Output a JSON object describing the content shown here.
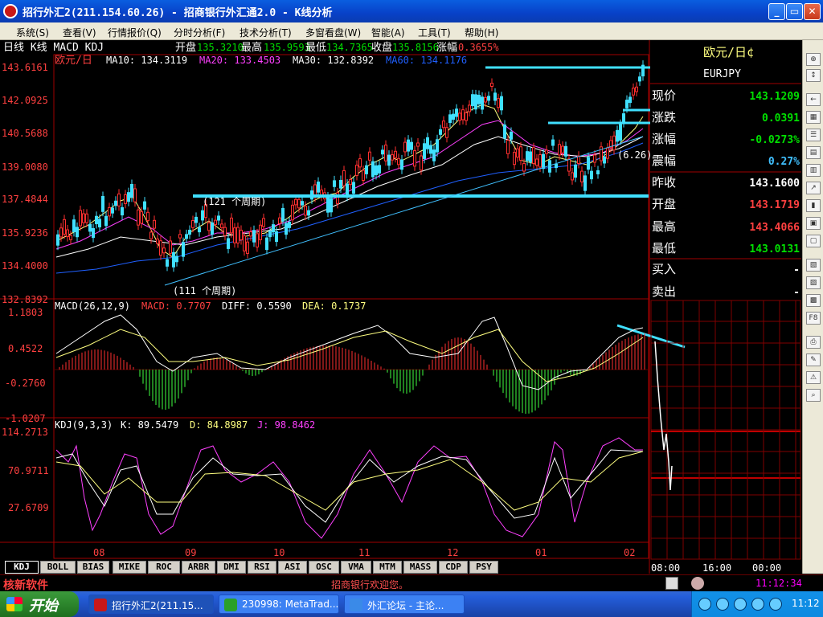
{
  "window": {
    "title": "招行外汇2(211.154.60.26) - 招商银行外汇通2.0 - K线分析"
  },
  "menu": [
    "系统(S)",
    "查看(V)",
    "行情报价(Q)",
    "分时分析(F)",
    "技术分析(T)",
    "多窗看盘(W)",
    "智能(A)",
    "工具(T)",
    "帮助(H)"
  ],
  "chart_header": {
    "mode": "日线 K线 MACD KDJ",
    "open_label": "开盘",
    "open": "135.3210",
    "high_label": "最高",
    "high": "135.9593",
    "low_label": "最低",
    "low": "134.7365",
    "close_label": "收盘",
    "close": "135.8156",
    "chg_label": "涨幅",
    "chg": "0.3655%"
  },
  "symbol_label": "欧元/日",
  "ma_legend": [
    {
      "text": "MA10: 134.3119",
      "color": "#ffffff"
    },
    {
      "text": "MA20: 133.4503",
      "color": "#ff40ff"
    },
    {
      "text": "MA30: 132.8392",
      "color": "#ffffff"
    },
    {
      "text": "MA60: 134.1176",
      "color": "#2060ff"
    }
  ],
  "price_axis": [
    "143.6161",
    "142.0925",
    "140.5688",
    "139.0080",
    "137.4844",
    "135.9236",
    "134.4000",
    "132.8392"
  ],
  "annotations": {
    "p121": "(121 个周期)",
    "p111": "(111 个周期)",
    "p6": "(6.26)"
  },
  "macd_header": {
    "label": "MACD(26,12,9)",
    "macd": "MACD: 0.7707",
    "diff": "DIFF: 0.5590",
    "dea": "DEA: 0.1737"
  },
  "macd_axis": [
    "1.1803",
    "0.4522",
    "-0.2760",
    "-1.0207"
  ],
  "kdj_header": {
    "label": "KDJ(9,3,3)",
    "k": "K: 89.5479",
    "d": "D: 84.8987",
    "j": "J: 98.8462"
  },
  "kdj_axis": [
    "114.2713",
    "70.9711",
    "27.6709"
  ],
  "x_axis": [
    "08",
    "09",
    "10",
    "11",
    "12",
    "01",
    "02"
  ],
  "intraday_axis": [
    "08:00",
    "16:00",
    "00:00"
  ],
  "quote": {
    "name": "欧元/日¢",
    "code": "EURJPY",
    "rows": [
      {
        "label": "现价",
        "value": "143.1209",
        "color": "#00e000"
      },
      {
        "label": "涨跌",
        "value": "0.0391",
        "color": "#00e000"
      },
      {
        "label": "涨幅",
        "value": "-0.0273%",
        "color": "#00e000"
      },
      {
        "label": "震幅",
        "value": "0.27%",
        "color": "#40c0ff"
      },
      {
        "label": "昨收",
        "value": "143.1600",
        "color": "#ffffff"
      },
      {
        "label": "开盘",
        "value": "143.1719",
        "color": "#ff4040"
      },
      {
        "label": "最高",
        "value": "143.4066",
        "color": "#ff4040"
      },
      {
        "label": "最低",
        "value": "143.0131",
        "color": "#00e000"
      },
      {
        "label": "买入",
        "value": "-",
        "color": "#ffffff"
      },
      {
        "label": "卖出",
        "value": "-",
        "color": "#ffffff"
      }
    ]
  },
  "tabs": [
    "KDJ",
    "BOLL",
    "BIAS",
    "MIKE",
    "ROC",
    "ARBR",
    "DMI",
    "RSI",
    "ASI",
    "OSC",
    "VMA",
    "MTM",
    "MASS",
    "CDP",
    "PSY"
  ],
  "status": {
    "brand": "核新软件",
    "welcome": "招商银行欢迎您。",
    "clock": "11:12:34"
  },
  "taskbar": {
    "start": "开始",
    "tasks": [
      "招行外汇2(211.15...",
      "230998: MetaTrad...",
      "外汇论坛 - 主论..."
    ],
    "time": "11:12"
  }
}
